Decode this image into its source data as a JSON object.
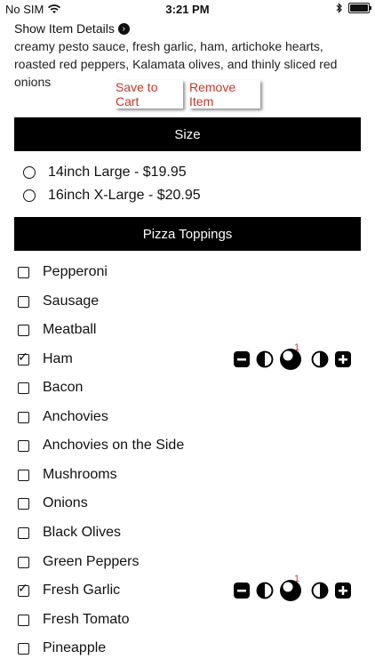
{
  "status_bar": {
    "carrier": "No SIM",
    "time": "3:21 PM"
  },
  "item": {
    "details_link": "Show Item Details",
    "description": "creamy pesto sauce, fresh garlic, ham, artichoke hearts, roasted red peppers, Kalamata olives, and thinly sliced red onions"
  },
  "actions": {
    "save_label": "Save to Cart",
    "remove_label": "Remove Item"
  },
  "size_section": {
    "title": "Size",
    "options": [
      {
        "label": "14inch Large - $19.95",
        "selected": false
      },
      {
        "label": "16inch X-Large - $20.95",
        "selected": false
      }
    ]
  },
  "toppings_section": {
    "title": "Pizza Toppings",
    "items": [
      {
        "label": "Pepperoni",
        "checked": false
      },
      {
        "label": "Sausage",
        "checked": false
      },
      {
        "label": "Meatball",
        "checked": false
      },
      {
        "label": "Ham",
        "checked": true,
        "portion_badge": "1"
      },
      {
        "label": "Bacon",
        "checked": false
      },
      {
        "label": "Anchovies",
        "checked": false
      },
      {
        "label": "Anchovies on the Side",
        "checked": false
      },
      {
        "label": "Mushrooms",
        "checked": false
      },
      {
        "label": "Onions",
        "checked": false
      },
      {
        "label": "Black Olives",
        "checked": false
      },
      {
        "label": "Green Peppers",
        "checked": false
      },
      {
        "label": "Fresh Garlic",
        "checked": true,
        "portion_badge": "1"
      },
      {
        "label": "Fresh Tomato",
        "checked": false
      },
      {
        "label": "Pineapple",
        "checked": false
      }
    ]
  },
  "colors": {
    "action_text": "#c0392b",
    "section_bar": "#000000",
    "badge": "#dd3333"
  },
  "icons": {
    "wifi": "wifi-icon",
    "bluetooth": "bluetooth-icon",
    "battery": "battery-icon",
    "details": "chevron-right-circle-icon",
    "minus": "minus-square-icon",
    "half_left": "left-half-icon",
    "whole": "whole-pizza-icon",
    "half_right": "right-half-icon",
    "plus": "plus-square-icon"
  }
}
